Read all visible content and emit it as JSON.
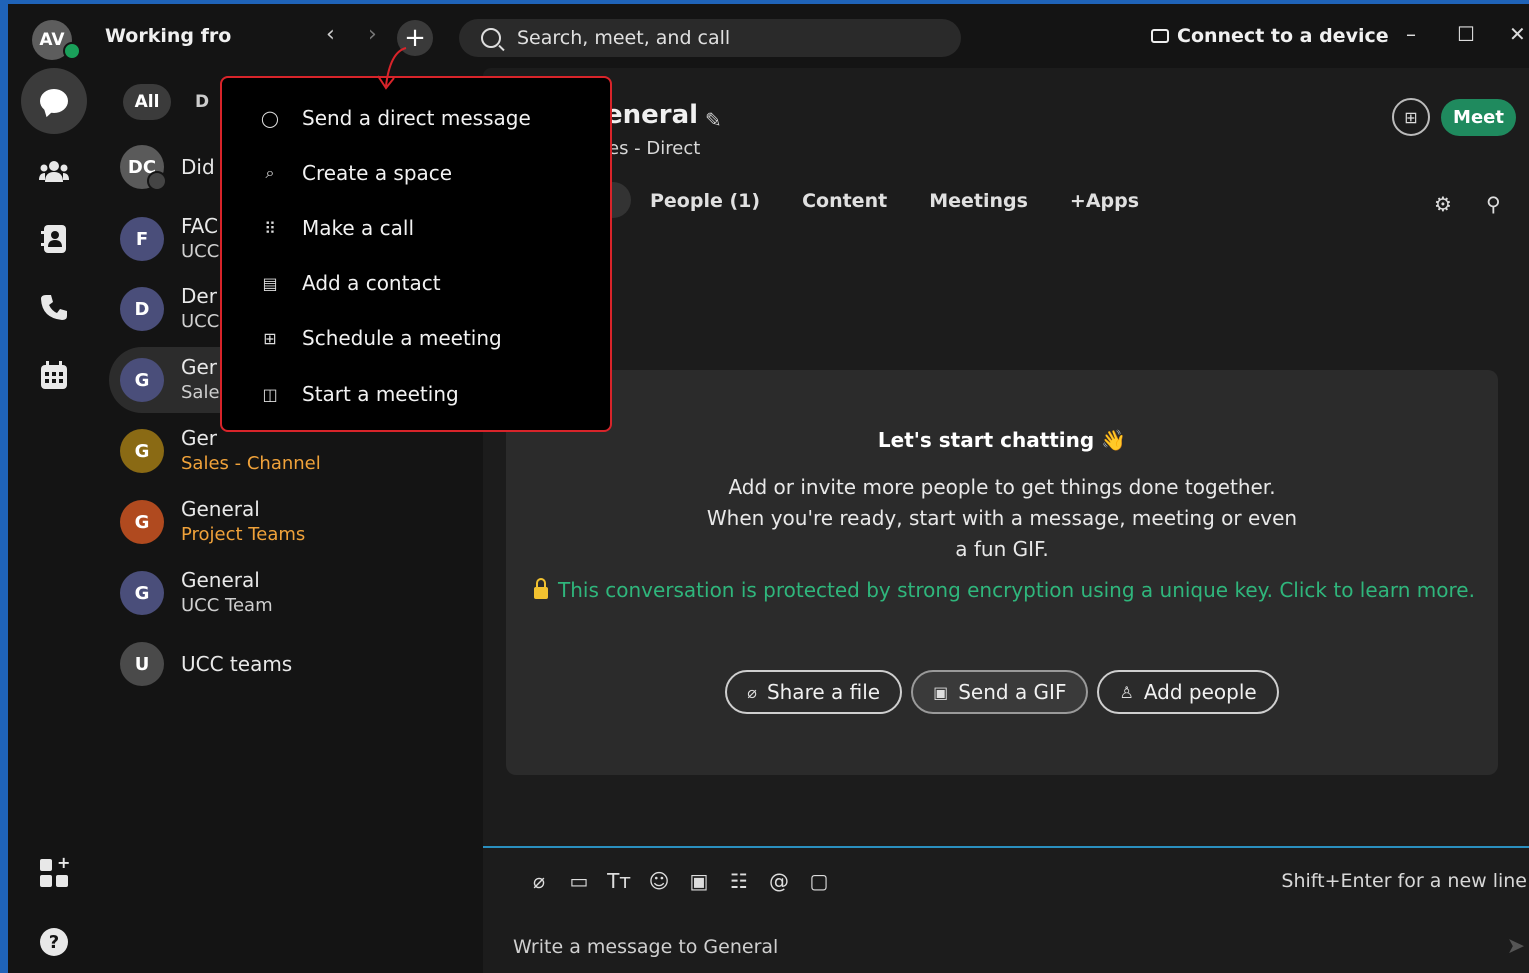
{
  "titlebar": {
    "avatar_initials": "AV",
    "status": "Working fro",
    "back": "‹",
    "forward": "›",
    "plus": "+",
    "search_placeholder": "Search, meet, and call",
    "connect_label": "Connect to a device",
    "minimize": "–",
    "maximize": "☐",
    "close": "✕"
  },
  "list": {
    "filter_all": "All",
    "filter_second": "D",
    "conversations": [
      {
        "initials": "DC",
        "title": "Did",
        "subtitle": "",
        "color": "#5a5a5a"
      },
      {
        "initials": "F",
        "title": "FAC",
        "subtitle": "UCC",
        "color": "#4a4e7a"
      },
      {
        "initials": "D",
        "title": "Der",
        "subtitle": "UCC",
        "color": "#4a4e7a"
      },
      {
        "initials": "G",
        "title": "Ger",
        "subtitle": "Sale",
        "color": "#4a4e7a"
      },
      {
        "initials": "G",
        "title": "Ger",
        "subtitle": "Sales - Channel",
        "color": "#8a6a14"
      },
      {
        "initials": "G",
        "title": "General",
        "subtitle": "Project Teams",
        "color": "#b04a1f"
      },
      {
        "initials": "G",
        "title": "General",
        "subtitle": "UCC Team",
        "color": "#4a4e7a"
      },
      {
        "initials": "U",
        "title": "UCC teams",
        "subtitle": "",
        "color": "#4a4a4a"
      }
    ]
  },
  "space": {
    "title": "eneral",
    "subtitle": "es - Direct",
    "meet_label": "Meet",
    "tabs": [
      "People (1)",
      "Content",
      "Meetings",
      "+Apps"
    ]
  },
  "card": {
    "heading": "Let's start chatting 👋",
    "lines": [
      "Add or invite more people to get things done together.",
      "When you're ready, start with a message, meeting or even",
      "a fun GIF."
    ],
    "encryption": "This conversation is protected by strong encryption using a unique key. Click to learn more.",
    "actions": {
      "share_file": "Share a file",
      "send_gif": "Send a GIF",
      "add_people": "Add people"
    }
  },
  "composer": {
    "hint": "Shift+Enter for a new line",
    "placeholder": "Write a message to General"
  },
  "menu": {
    "items": [
      {
        "label": "Send a direct message",
        "icon": "chat-bubble-icon"
      },
      {
        "label": "Create a space",
        "icon": "create-space-icon"
      },
      {
        "label": "Make a call",
        "icon": "dialpad-icon"
      },
      {
        "label": "Add a contact",
        "icon": "contact-card-icon"
      },
      {
        "label": "Schedule a meeting",
        "icon": "calendar-add-icon"
      },
      {
        "label": "Start a meeting",
        "icon": "video-icon"
      }
    ]
  },
  "colors": {
    "accent_green": "#1f8a5e",
    "encryption_text": "#2fb67c",
    "highlight_border": "#d8242a",
    "desktop_blue": "#1f63b8"
  }
}
